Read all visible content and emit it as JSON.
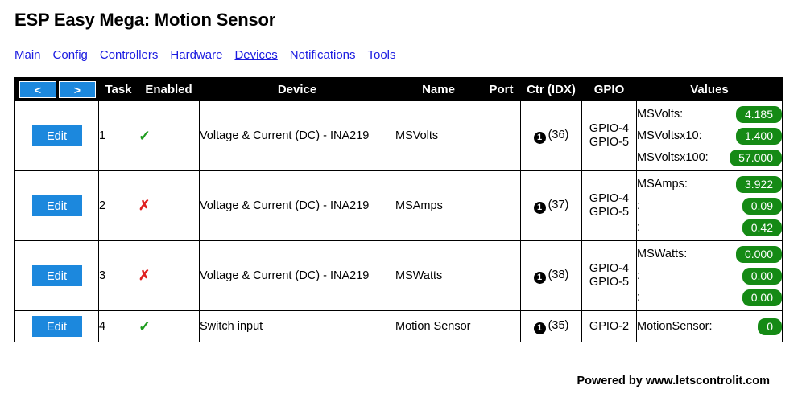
{
  "header": {
    "title": "ESP Easy Mega: Motion Sensor"
  },
  "nav": {
    "items": [
      {
        "label": "Main",
        "active": false
      },
      {
        "label": "Config",
        "active": false
      },
      {
        "label": "Controllers",
        "active": false
      },
      {
        "label": "Hardware",
        "active": false
      },
      {
        "label": "Devices",
        "active": true
      },
      {
        "label": "Notifications",
        "active": false
      },
      {
        "label": "Tools",
        "active": false
      }
    ]
  },
  "table": {
    "pager": {
      "prev_label": "<",
      "next_label": ">"
    },
    "columns": [
      "Task",
      "Enabled",
      "Device",
      "Name",
      "Port",
      "Ctr (IDX)",
      "GPIO",
      "Values"
    ],
    "edit_label": "Edit",
    "enabled_yes": "✓",
    "enabled_no": "✗",
    "rows": [
      {
        "edit": "Edit",
        "task": "1",
        "enabled": true,
        "device": "Voltage & Current (DC) - INA219",
        "name": "MSVolts",
        "port": "",
        "ctr_badge": "1",
        "ctr_idx": "(36)",
        "gpio": [
          "GPIO-4",
          "GPIO-5"
        ],
        "values": [
          {
            "label": "MSVolts:",
            "value": "4.185"
          },
          {
            "label": "MSVoltsx10:",
            "value": "1.400"
          },
          {
            "label": "MSVoltsx100:",
            "value": "57.000"
          }
        ]
      },
      {
        "edit": "Edit",
        "task": "2",
        "enabled": false,
        "device": "Voltage & Current (DC) - INA219",
        "name": "MSAmps",
        "port": "",
        "ctr_badge": "1",
        "ctr_idx": "(37)",
        "gpio": [
          "GPIO-4",
          "GPIO-5"
        ],
        "values": [
          {
            "label": "MSAmps:",
            "value": "3.922"
          },
          {
            "label": ":",
            "value": "0.09"
          },
          {
            "label": ":",
            "value": "0.42"
          }
        ]
      },
      {
        "edit": "Edit",
        "task": "3",
        "enabled": false,
        "device": "Voltage & Current (DC) - INA219",
        "name": "MSWatts",
        "port": "",
        "ctr_badge": "1",
        "ctr_idx": "(38)",
        "gpio": [
          "GPIO-4",
          "GPIO-5"
        ],
        "values": [
          {
            "label": "MSWatts:",
            "value": "0.000"
          },
          {
            "label": ":",
            "value": "0.00"
          },
          {
            "label": ":",
            "value": "0.00"
          }
        ]
      },
      {
        "edit": "Edit",
        "task": "4",
        "enabled": true,
        "device": "Switch input",
        "name": "Motion Sensor",
        "port": "",
        "ctr_badge": "1",
        "ctr_idx": "(35)",
        "gpio": [
          "GPIO-2"
        ],
        "values": [
          {
            "label": "MotionSensor:",
            "value": "0"
          }
        ]
      }
    ]
  },
  "footer": {
    "text": "Powered by www.letscontrolit.com"
  },
  "colors": {
    "link": "#1a1ae0",
    "button_blue": "#1c88dd",
    "badge_green": "#158a15",
    "header_black": "#000000",
    "ok_green": "#1f9c1f",
    "no_red": "#e02020"
  }
}
